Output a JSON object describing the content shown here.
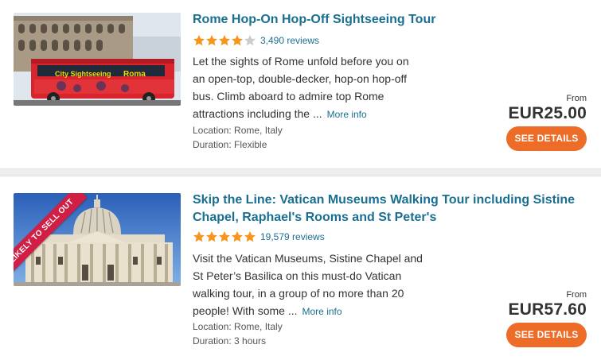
{
  "tours": [
    {
      "title": "Rome Hop-On Hop-Off Sightseeing Tour",
      "rating": 4,
      "rating_max": 5,
      "reviews": "3,490 reviews",
      "description": "Let the sights of Rome unfold before you on an open-top, double-decker, hop-on hop-off bus. Climb aboard to admire top Rome attractions including the ...",
      "more_info": "More info",
      "location": "Location: Rome, Italy",
      "duration": "Duration: Flexible",
      "from": "From",
      "price": "EUR25.00",
      "button": "SEE DETAILS",
      "badge": ""
    },
    {
      "title": "Skip the Line: Vatican Museums Walking Tour including Sistine Chapel, Raphael's Rooms and St Peter's",
      "rating": 5,
      "rating_max": 5,
      "reviews": "19,579 reviews",
      "description": "Visit the Vatican Museums, Sistine Chapel and St Peter’s Basilica on this must-do Vatican walking tour, in a group of no more than 20 people! With some ...",
      "more_info": "More info",
      "location": "Location: Rome, Italy",
      "duration": "Duration: 3 hours",
      "from": "From",
      "price": "EUR57.60",
      "button": "SEE DETAILS",
      "badge": "LIKELY TO SELL OUT"
    }
  ],
  "colors": {
    "link": "#1a6f91",
    "star": "#f7941d",
    "star_empty": "#cccccc",
    "button": "#ec6c28",
    "badge": "#d11e44"
  },
  "icons": {
    "star": "star-icon"
  }
}
